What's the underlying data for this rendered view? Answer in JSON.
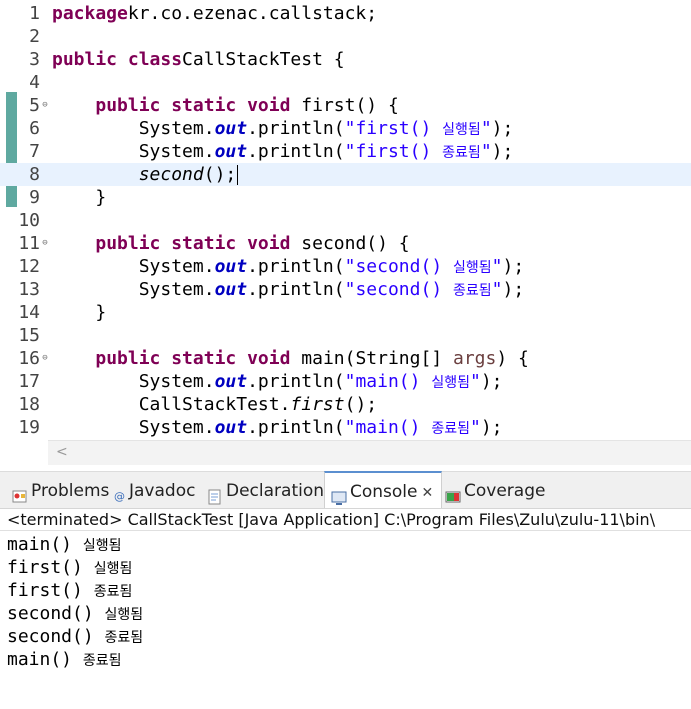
{
  "editor": {
    "lines": [
      {
        "n": "1",
        "parts": [
          [
            "kw",
            "package"
          ],
          [
            "",
            "kr.co.ezenac.callstack;"
          ]
        ]
      },
      {
        "n": "2",
        "parts": []
      },
      {
        "n": "3",
        "parts": [
          [
            "kw",
            "public class"
          ],
          [
            "",
            "CallStackTest {"
          ]
        ]
      },
      {
        "n": "4",
        "parts": []
      },
      {
        "n": "5",
        "fold": true,
        "parts": [
          [
            "",
            "    "
          ],
          [
            "kw",
            "public static void"
          ],
          [
            "",
            " first() {"
          ]
        ]
      },
      {
        "n": "6",
        "parts": [
          [
            "",
            "        System."
          ],
          [
            "fld",
            "out"
          ],
          [
            "",
            ".println("
          ],
          [
            "str",
            "\"first() "
          ],
          [
            "strkr",
            "실행됨"
          ],
          [
            "str",
            "\""
          ],
          [
            "",
            ");"
          ]
        ]
      },
      {
        "n": "7",
        "parts": [
          [
            "",
            "        System."
          ],
          [
            "fld",
            "out"
          ],
          [
            "",
            ".println("
          ],
          [
            "str",
            "\"first() "
          ],
          [
            "strkr",
            "종료됨"
          ],
          [
            "str",
            "\""
          ],
          [
            "",
            ");"
          ]
        ]
      },
      {
        "n": "8",
        "current": true,
        "parts": [
          [
            "",
            "        "
          ],
          [
            "it",
            "second"
          ],
          [
            "",
            "();"
          ],
          [
            "cursor",
            ""
          ]
        ]
      },
      {
        "n": "9",
        "parts": [
          [
            "",
            "    }"
          ]
        ]
      },
      {
        "n": "10",
        "parts": []
      },
      {
        "n": "11",
        "fold": true,
        "parts": [
          [
            "",
            "    "
          ],
          [
            "kw",
            "public static void"
          ],
          [
            "",
            " second() {"
          ]
        ]
      },
      {
        "n": "12",
        "parts": [
          [
            "",
            "        System."
          ],
          [
            "fld",
            "out"
          ],
          [
            "",
            ".println("
          ],
          [
            "str",
            "\"second() "
          ],
          [
            "strkr",
            "실행됨"
          ],
          [
            "str",
            "\""
          ],
          [
            "",
            ");"
          ]
        ]
      },
      {
        "n": "13",
        "parts": [
          [
            "",
            "        System."
          ],
          [
            "fld",
            "out"
          ],
          [
            "",
            ".println("
          ],
          [
            "str",
            "\"second() "
          ],
          [
            "strkr",
            "종료됨"
          ],
          [
            "str",
            "\""
          ],
          [
            "",
            ");"
          ]
        ]
      },
      {
        "n": "14",
        "parts": [
          [
            "",
            "    }"
          ]
        ]
      },
      {
        "n": "15",
        "parts": []
      },
      {
        "n": "16",
        "fold": true,
        "parts": [
          [
            "",
            "    "
          ],
          [
            "kw",
            "public static void"
          ],
          [
            "",
            " main(String[] "
          ],
          [
            "arg",
            "args"
          ],
          [
            "",
            ") {"
          ]
        ]
      },
      {
        "n": "17",
        "parts": [
          [
            "",
            "        System."
          ],
          [
            "fld",
            "out"
          ],
          [
            "",
            ".println("
          ],
          [
            "str",
            "\"main() "
          ],
          [
            "strkr",
            "실행됨"
          ],
          [
            "str",
            "\""
          ],
          [
            "",
            ");"
          ]
        ]
      },
      {
        "n": "18",
        "parts": [
          [
            "",
            "        CallStackTest."
          ],
          [
            "it",
            "first"
          ],
          [
            "",
            "();"
          ]
        ]
      },
      {
        "n": "19",
        "parts": [
          [
            "",
            "        System."
          ],
          [
            "fld",
            "out"
          ],
          [
            "",
            ".println("
          ],
          [
            "str",
            "\"main() "
          ],
          [
            "strkr",
            "종료됨"
          ],
          [
            "str",
            "\""
          ],
          [
            "",
            ");"
          ]
        ]
      }
    ]
  },
  "tabs": {
    "problems": "Problems",
    "javadoc": "Javadoc",
    "declaration": "Declaration",
    "console": "Console",
    "close": "✕",
    "coverage": "Coverage"
  },
  "status": "<terminated> CallStackTest [Java Application] C:\\Program Files\\Zulu\\zulu-11\\bin\\",
  "console_output": [
    [
      "main()",
      "실행됨"
    ],
    [
      "first()",
      "실행됨"
    ],
    [
      "first()",
      "종료됨"
    ],
    [
      "second()",
      "실행됨"
    ],
    [
      "second()",
      "종료됨"
    ],
    [
      "main()",
      "종료됨"
    ]
  ],
  "colors": {
    "keyword": "#7f0055",
    "string": "#2a00ff",
    "field": "#0000c0",
    "current_line": "#e8f2fe",
    "change_bar": "#5fa9a0"
  }
}
